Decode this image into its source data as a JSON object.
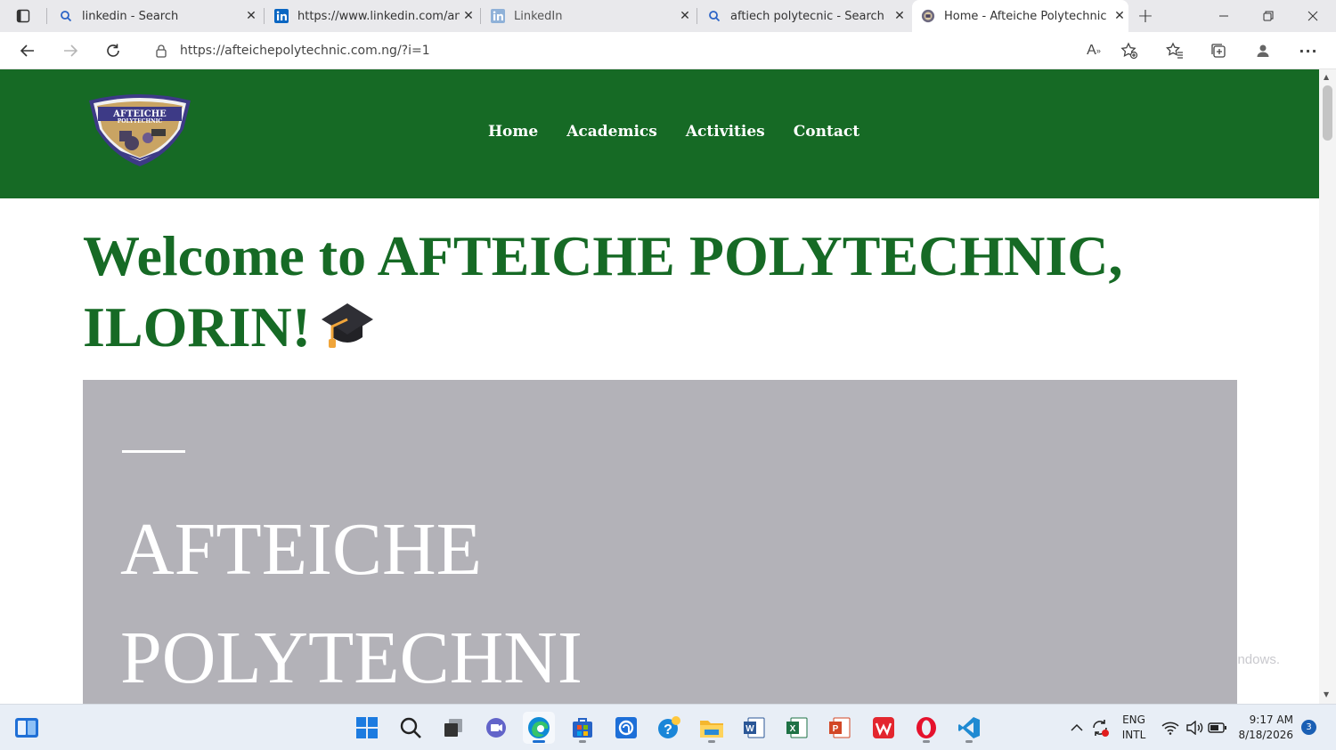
{
  "browser": {
    "tabs": [
      {
        "title": "linkedin - Search",
        "favicon": "search-icon",
        "active": false
      },
      {
        "title": "https://www.linkedin.com/an",
        "favicon": "linkedin-icon",
        "active": false
      },
      {
        "title": "LinkedIn",
        "favicon": "linkedin-icon",
        "active": false
      },
      {
        "title": "aftiech polytecnic - Search",
        "favicon": "search-icon",
        "active": false
      },
      {
        "title": "Home - Afteiche Polytechnic",
        "favicon": "school-logo-icon",
        "active": true
      }
    ],
    "url": "https://afteichepolytechnic.com.ng/?i=1"
  },
  "site": {
    "nav": [
      "Home",
      "Academics",
      "Activities",
      "Contact"
    ],
    "welcome_line1": "Welcome to AFTEICHE POLYTECHNIC,",
    "welcome_line2": "ILORIN!",
    "hero_line1": "AFTEICHE",
    "hero_line2": "POLYTECHNI",
    "logo_text_1": "AFTEICHE",
    "logo_text_2": "POLYTECHNIC",
    "overlay_text": "ndows."
  },
  "colors": {
    "header_green": "#166a25",
    "hero_gray": "#b3b2b8",
    "accent_blue": "#1c6fd1"
  },
  "taskbar": {
    "apps": [
      "widgets-icon",
      "start-icon",
      "search-icon",
      "task-view-icon",
      "teams-chat-icon",
      "edge-icon",
      "store-icon",
      "app-icon",
      "help-icon",
      "file-explorer-icon",
      "word-icon",
      "excel-icon",
      "powerpoint-icon",
      "wps-icon",
      "opera-icon",
      "vscode-icon"
    ],
    "lang_line1": "ENG",
    "lang_line2": "INTL",
    "time": "9:17 AM",
    "date": "8/18/2026",
    "notifications": "3"
  }
}
